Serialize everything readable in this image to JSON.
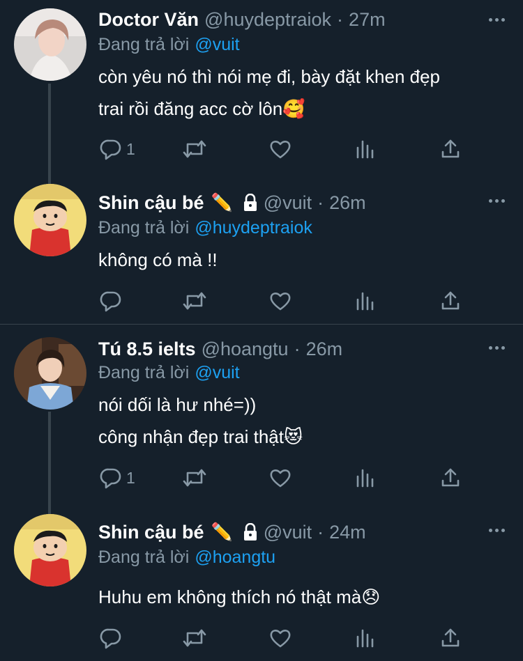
{
  "reply_prefix": "Đang trả lời",
  "tweets": [
    {
      "name": "Doctor Văn",
      "handle": "@huydeptraiok",
      "time": "27m",
      "reply_to": "@vuit",
      "lines": [
        "còn yêu nó thì nói mẹ đi, bày đặt khen đẹp",
        "trai rồi đăng acc cờ lôn🥰"
      ],
      "reply_count": "1"
    },
    {
      "name": "Shin cậu bé",
      "name_emoji": "✏️",
      "handle": "@vuit",
      "time": "26m",
      "reply_to": "@huydeptraiok",
      "lines": [
        "không có mà !!"
      ],
      "reply_count": ""
    },
    {
      "name": "Tú 8.5 ielts",
      "handle": "@hoangtu",
      "time": "26m",
      "reply_to": "@vuit",
      "lines": [
        "nói dối là hư nhé=))",
        "công nhận đẹp trai thật😻"
      ],
      "reply_count": "1"
    },
    {
      "name": "Shin cậu bé",
      "name_emoji": "✏️",
      "handle": "@vuit",
      "time": "24m",
      "reply_to": "@hoangtu",
      "lines": [
        "Huhu em không thích nó thật mà😞"
      ],
      "reply_count": ""
    }
  ],
  "icons": {
    "reply": "reply-bubble-icon",
    "retweet": "retweet-icon",
    "like": "heart-icon",
    "analytics": "analytics-icon",
    "share": "share-icon",
    "more": "more-dots-icon",
    "lock": "lock-icon"
  },
  "colors": {
    "background": "#15202b",
    "text": "#ffffff",
    "secondary": "#8899a6",
    "link": "#1da1f2",
    "divider": "#38444d"
  }
}
